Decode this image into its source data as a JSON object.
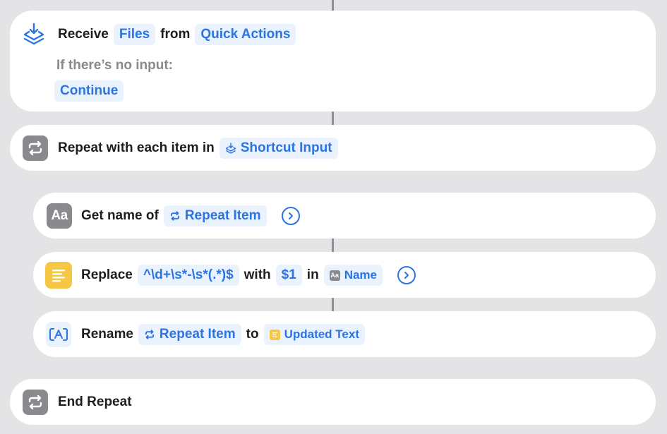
{
  "receive": {
    "verb": "Receive",
    "type_token": "Files",
    "from_word": "from",
    "source_token": "Quick Actions",
    "no_input_label": "If there’s no input:",
    "no_input_value": "Continue"
  },
  "repeat": {
    "label": "Repeat with each item in",
    "input_token": "Shortcut Input"
  },
  "get_name": {
    "label": "Get name of",
    "icon_text": "Aa",
    "item_token": "Repeat Item"
  },
  "replace": {
    "label": "Replace",
    "pattern_token": "^\\d+\\s*-\\s*(.*)$",
    "with_word": "with",
    "replacement_token": "$1",
    "in_word": "in",
    "target_token": "Name",
    "target_icon_text": "Aa"
  },
  "rename": {
    "label": "Rename",
    "item_token": "Repeat Item",
    "to_word": "to",
    "new_name_token": "Updated Text"
  },
  "end_repeat": {
    "label": "End Repeat"
  },
  "colors": {
    "accent": "#2b74e2",
    "token_bg": "#eaf2fd",
    "gray_icon": "#8a8a8e",
    "text_yellow": "#f6c745",
    "background": "#e4e4e6"
  },
  "icons": {
    "receive": "layers-download-icon",
    "repeat": "repeat-arrows-icon",
    "get_name": "text-aa-icon",
    "replace": "text-lines-icon",
    "rename": "rename-field-icon",
    "chevron": "chevron-right-circle-icon"
  }
}
